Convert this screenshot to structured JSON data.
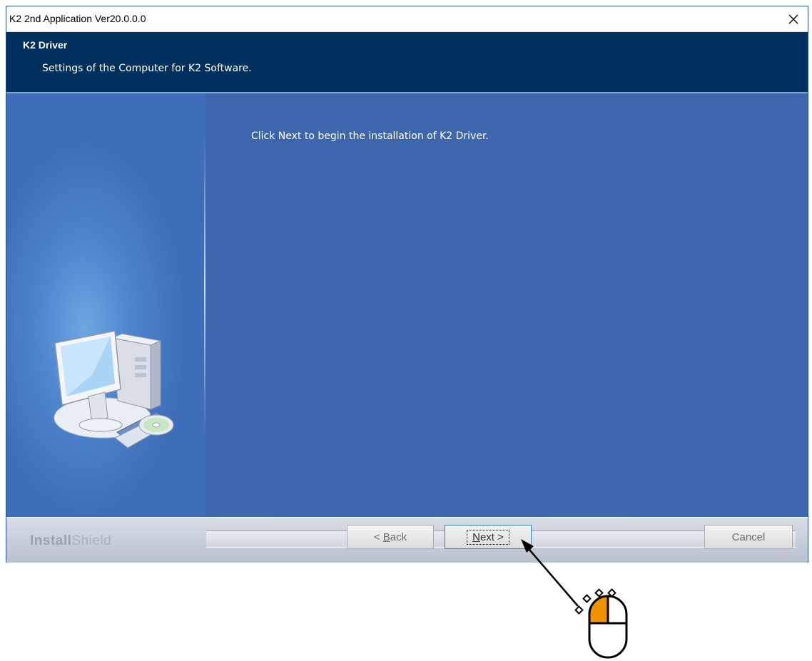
{
  "window": {
    "title": "K2 2nd Application Ver20.0.0.0"
  },
  "header": {
    "title": "K2 Driver",
    "subtitle": "Settings of the Computer for K2 Software."
  },
  "main": {
    "message": "Click Next to begin the installation of K2 Driver."
  },
  "footer": {
    "brand_bold": "Install",
    "brand_light": "Shield",
    "back_prefix": "< ",
    "back_accel": "B",
    "back_rest": "ack",
    "next_accel": "N",
    "next_rest": "ext >",
    "cancel_label": "Cancel"
  },
  "icons": {
    "close": "close-icon",
    "computer": "computer-cd-icon",
    "mouse": "mouse-left-click-icon",
    "arrow": "pointer-arrow-icon"
  },
  "colors": {
    "header_bg": "#00305e",
    "main_bg": "#3e66ad",
    "mouse_accent": "#f39200"
  }
}
